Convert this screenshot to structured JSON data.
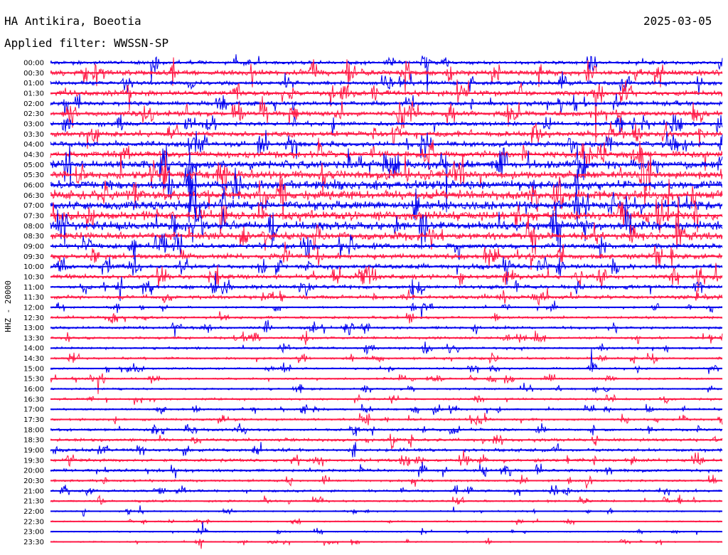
{
  "header": {
    "station": "HA Antikira, Boeotia",
    "date": "2025-03-05",
    "filter": "Applied filter: WWSSN-SP"
  },
  "side_label": "HHZ - 20000",
  "colors": {
    "trace_a": "#0000ee",
    "trace_b": "#ff1744",
    "text": "#000000",
    "background": "#ffffff"
  },
  "chart_data": {
    "type": "line",
    "title": "",
    "xlabel": "",
    "ylabel": "HHZ - 20000",
    "rows": [
      "00:00",
      "00:30",
      "01:00",
      "01:30",
      "02:00",
      "02:30",
      "03:00",
      "03:30",
      "04:00",
      "04:30",
      "05:00",
      "05:30",
      "06:00",
      "06:30",
      "07:00",
      "07:30",
      "08:00",
      "08:30",
      "09:00",
      "09:30",
      "10:00",
      "10:30",
      "11:00",
      "11:30",
      "12:00",
      "12:30",
      "13:00",
      "13:30",
      "14:00",
      "14:30",
      "15:00",
      "15:30",
      "16:00",
      "16:30",
      "17:00",
      "17:30",
      "18:00",
      "18:30",
      "19:00",
      "19:30",
      "20:00",
      "20:30",
      "21:00",
      "21:30",
      "22:00",
      "22:30",
      "23:00",
      "23:30"
    ],
    "series": [
      {
        "color": "blue",
        "rows": "even"
      },
      {
        "color": "red",
        "rows": "odd"
      }
    ],
    "relative_amplitude": [
      2.2,
      3.4,
      2.6,
      3.2,
      2.6,
      3.2,
      2.6,
      3.2,
      3.2,
      3.8,
      5.0,
      5.4,
      5.4,
      5.6,
      5.6,
      5.6,
      5.2,
      4.6,
      3.2,
      3.2,
      2.8,
      2.8,
      2.4,
      2.2,
      1.2,
      1.6,
      1.6,
      1.6,
      1.4,
      1.4,
      1.2,
      1.2,
      1.2,
      1.2,
      1.2,
      1.4,
      1.6,
      1.8,
      1.8,
      1.8,
      1.8,
      1.4,
      1.4,
      1.2,
      1.0,
      0.8,
      0.8,
      0.8
    ]
  }
}
